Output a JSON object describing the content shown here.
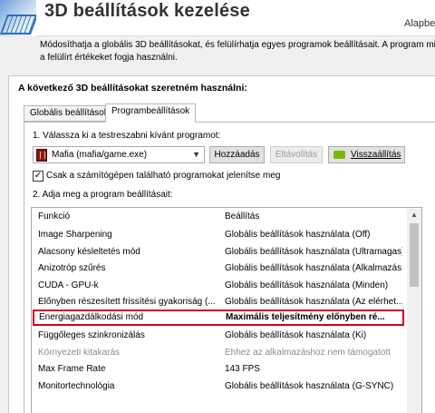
{
  "header": {
    "title": "3D beállítások kezelése",
    "right_text": "Alapbe"
  },
  "description": {
    "line1": "Módosíthatja a globális 3D beállításokat, és felülírhatja egyes programok beállításait. A program minde",
    "line2": "a felülírt értékeket fogja használni."
  },
  "section_label": "A következő 3D beállításokat szeretném használni:",
  "tabs": [
    {
      "label": "Globális beállítások",
      "active": false
    },
    {
      "label": "Programbeállítások",
      "active": true
    }
  ],
  "step1": {
    "label": "1. Válassza ki a testreszabni kívánt programot:",
    "selected_program": "Mafia (mafia/game.exe)",
    "add_button": "Hozzáadás",
    "remove_button": "Eltávolítás",
    "restore_button": "Visszaállítás"
  },
  "checkbox": {
    "label": "Csak a számítógépen található programokat jelenítse meg",
    "checked": true
  },
  "step2": {
    "label": "2. Adja meg a program beállításait:"
  },
  "table": {
    "headers": {
      "function": "Funkció",
      "setting": "Beállítás"
    },
    "rows": [
      {
        "function": "Image Sharpening",
        "setting": "Globális beállítások használata (Off)",
        "state": "normal"
      },
      {
        "function": "Alacsony késleltetés mód",
        "setting": "Globális beállítások használata (Ultramagas)",
        "state": "normal"
      },
      {
        "function": "Anizotróp szűrés",
        "setting": "Globális beállítások használata (Alkalmazás...",
        "state": "normal"
      },
      {
        "function": "CUDA - GPU-k",
        "setting": "Globális beállítások használata (Minden)",
        "state": "normal"
      },
      {
        "function": "Előnyben részesített frissítési gyakoriság (...",
        "setting": "Globális beállítások használata (Az elérhet...",
        "state": "normal"
      },
      {
        "function": "Energiagazdálkodási mód",
        "setting": "Maximális teljesítmény előnyben ré...",
        "state": "highlight"
      },
      {
        "function": "Függőleges szinkronizálás",
        "setting": "Globális beállítások használata (Ki)",
        "state": "normal"
      },
      {
        "function": "Környezeti kitakarás",
        "setting": "Ehhez az alkalmazáshoz nem támogatott",
        "state": "muted"
      },
      {
        "function": "Max Frame Rate",
        "setting": "143 FPS",
        "state": "normal"
      },
      {
        "function": "Monitortechnológia",
        "setting": "Globális beállítások használata (G-SYNC)",
        "state": "normal"
      }
    ]
  },
  "colors": {
    "highlight_border": "#d0021b",
    "nvidia_green": "#76b900"
  }
}
